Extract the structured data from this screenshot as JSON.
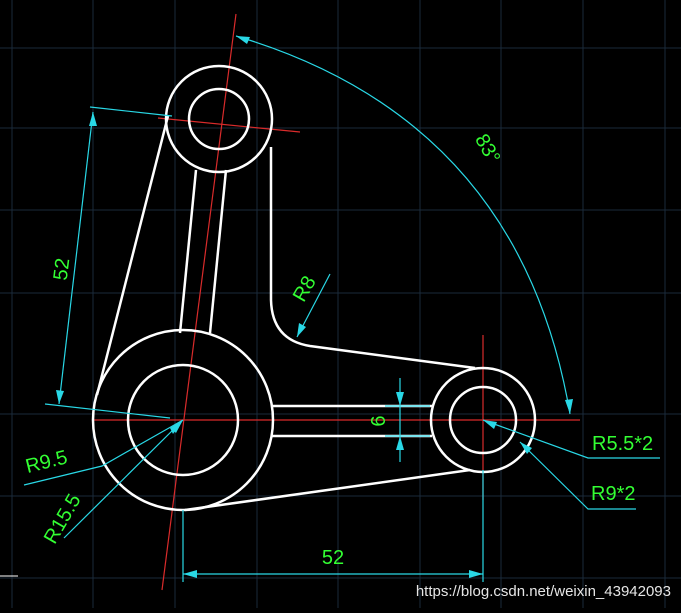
{
  "colors": {
    "background": "#000000",
    "grid": "#1a2a3a",
    "outline": "#ffffff",
    "centerline": "#d92b2b",
    "dimension": "#29d8e6",
    "dimension_text": "#33ff33",
    "watermark": "#e6e6e6"
  },
  "dimensions": {
    "top_distance": "52",
    "bottom_distance": "52",
    "angle": "83°",
    "fillet": "R8",
    "slot_width": "6",
    "small_hole": "R5.5*2",
    "small_boss": "R9*2",
    "left_hole": "R9.5",
    "left_boss": "R15.5"
  },
  "watermark": "https://blog.csdn.net/weixin_43942093"
}
